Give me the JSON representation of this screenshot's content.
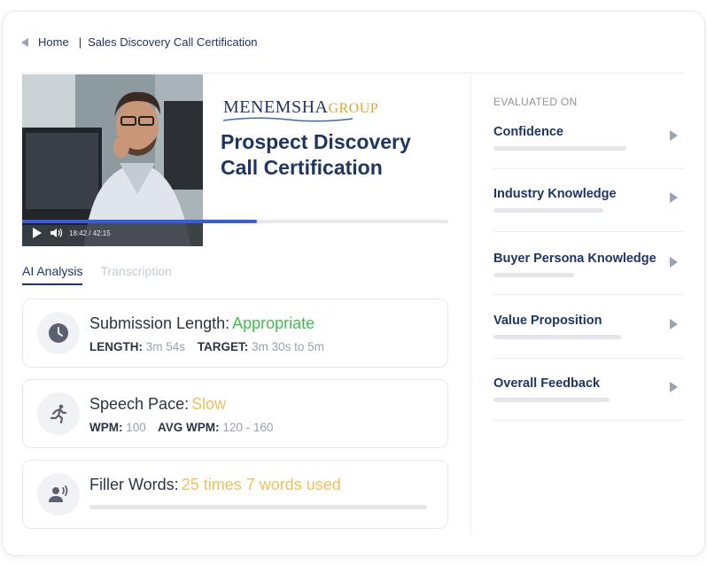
{
  "breadcrumb": {
    "home": "Home",
    "separator": "|",
    "current": "Sales Discovery Call Certification"
  },
  "video": {
    "time": "18:42 / 42:15",
    "progress": 0.55
  },
  "logo": {
    "part1": "MENEMSHA",
    "part2": "GROUP"
  },
  "title": "Prospect Discovery Call Certification",
  "tabs": [
    {
      "label": "AI Analysis"
    },
    {
      "label": "Transcription"
    }
  ],
  "analysis": {
    "submission": {
      "label": "Submission Length:",
      "value": "Appropriate",
      "length_label": "LENGTH:",
      "length_value": "3m 54s",
      "target_label": "TARGET:",
      "target_value": "3m 30s to 5m"
    },
    "speech": {
      "label": "Speech Pace:",
      "value": "Slow",
      "wpm_label": "WPM:",
      "wpm_value": "100",
      "avg_label": "AVG WPM:",
      "avg_value": "120 - 160"
    },
    "filler": {
      "label": "Filler Words:",
      "value": "25 times 7 words used"
    }
  },
  "sidebar": {
    "heading": "EVALUATED ON",
    "items": [
      {
        "label": "Confidence",
        "level": 0.79
      },
      {
        "label": "Industry Knowledge",
        "level": 0.65
      },
      {
        "label": "Buyer Persona Knowledge",
        "level": 0.48
      },
      {
        "label": "Value Proposition",
        "level": 0.76
      },
      {
        "label": "Overall Feedback",
        "level": 0.69
      }
    ]
  },
  "colors": {
    "accent": "#1f3566",
    "progress": "#3b5bdb",
    "good": "#3fbf4f",
    "warn": "#f4bf57"
  }
}
